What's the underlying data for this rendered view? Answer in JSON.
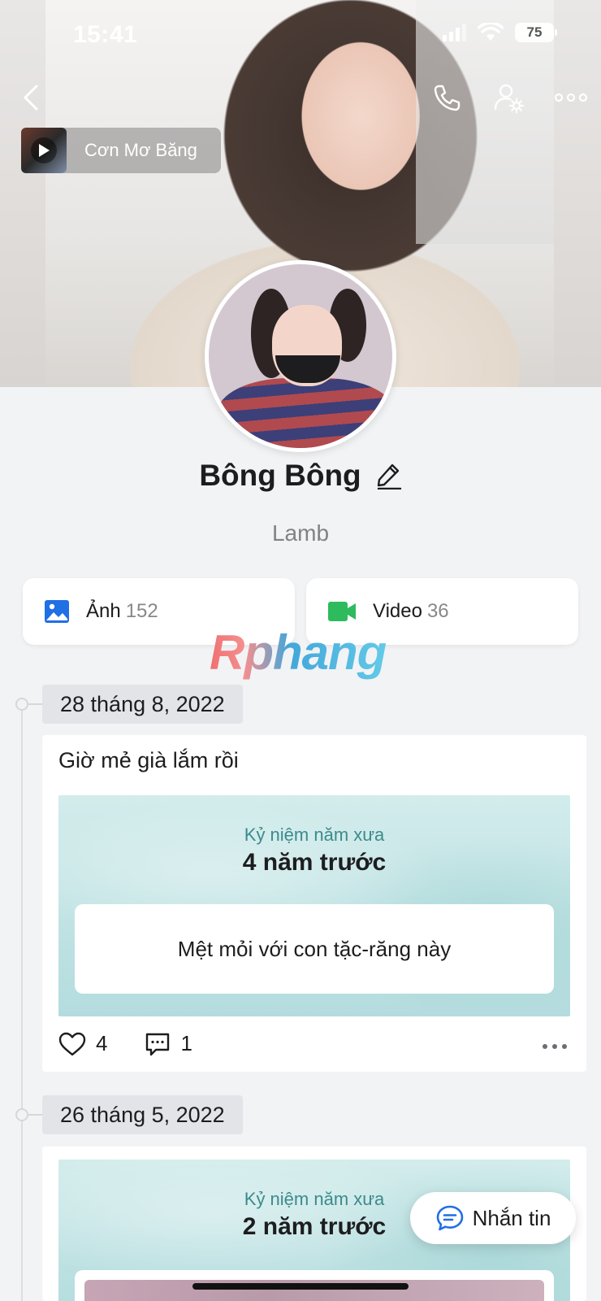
{
  "status_bar": {
    "time": "15:41",
    "battery": "75"
  },
  "music": {
    "title": "Cơn Mơ Băng"
  },
  "profile": {
    "name": "Bông Bông",
    "subtitle": "Lamb"
  },
  "media": {
    "photos": {
      "label": "Ảnh",
      "count": "152"
    },
    "videos": {
      "label": "Video",
      "count": "36"
    }
  },
  "watermark": "Rphang",
  "posts": [
    {
      "date": "28 tháng 8, 2022",
      "text": "Giờ mẻ già lắm rồi",
      "memory_kicker": "Kỷ niệm năm xưa",
      "memory_title": "4 năm trước",
      "memory_text": "Mệt mỏi với con tặc-răng này",
      "likes": "4",
      "comments": "1"
    },
    {
      "date": "26 tháng 5, 2022",
      "memory_kicker": "Kỷ niệm năm xưa",
      "memory_title": "2 năm trước"
    }
  ],
  "chat_button": {
    "label": "Nhắn tin"
  },
  "colors": {
    "accent_blue": "#1f6fe5",
    "video_green": "#2dbb5d",
    "memory_teal": "#c3e4e5"
  }
}
